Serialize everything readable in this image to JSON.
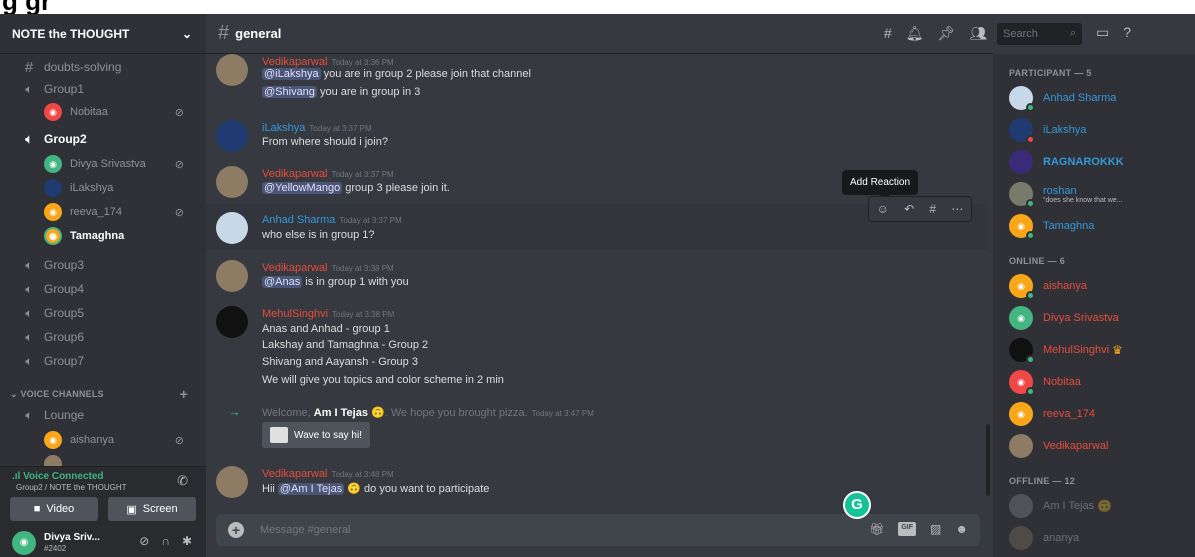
{
  "colors": {
    "online": "#43b581",
    "dnd": "#f04747",
    "idle": "#faa61a",
    "red_name": "#e74c3c",
    "blue_name": "#3498db",
    "accent": "#7289da"
  },
  "overlay_title": "g gr",
  "server": {
    "name": "NOTE the THOUGHT"
  },
  "sidebar": {
    "channels": [
      {
        "icon": "hash-icon",
        "label": "doubts-solving"
      },
      {
        "icon": "speaker-icon",
        "label": "Group1"
      },
      {
        "icon": "speaker-icon",
        "label": "Group2"
      },
      {
        "icon": "speaker-icon",
        "label": "Group3"
      },
      {
        "icon": "locked-speaker-icon",
        "label": "Group4"
      },
      {
        "icon": "locked-speaker-icon",
        "label": "Group5"
      },
      {
        "icon": "locked-speaker-icon",
        "label": "Group6"
      },
      {
        "icon": "locked-speaker-icon",
        "label": "Group7"
      },
      {
        "icon": "speaker-icon",
        "label": "Lounge"
      }
    ],
    "group1_users": [
      {
        "name": "Nobitaa"
      }
    ],
    "group2_users": [
      {
        "name": "Divya Srivastva"
      },
      {
        "name": "iLakshya"
      },
      {
        "name": "reeva_174"
      },
      {
        "name": "Tamaghna"
      }
    ],
    "lounge_users": [
      {
        "name": "aishanya"
      }
    ],
    "voice_category": "VOICE CHANNELS"
  },
  "voice": {
    "status": "Voice Connected",
    "location": "Group2 / NOTE the THOUGHT",
    "video_label": "Video",
    "screen_label": "Screen"
  },
  "user_panel": {
    "name": "Divya Sriv...",
    "tag": "#2402"
  },
  "channel": {
    "name": "general",
    "input_placeholder": "Message #general"
  },
  "search": {
    "placeholder": "Search"
  },
  "messages": [
    {
      "author": "Vedikaparwal",
      "time": "Today at 3:36 PM"
    },
    {
      "author": "iLakshya",
      "time": "Today at 3:37 PM",
      "text": "From where should i join?"
    },
    {
      "author": "Vedikaparwal",
      "time": "Today at 3:37 PM"
    },
    {
      "author": "Anhad Sharma",
      "time": "Today at 3:37 PM",
      "text": "who else is in group 1?"
    },
    {
      "author": "Vedikaparwal",
      "time": "Today at 3:38 PM"
    },
    {
      "author": "MehulSinghvi",
      "time": "Today at 3:38 PM",
      "lines": [
        "Anas and Anhad - group 1",
        "Lakshay and Tamaghna - Group 2",
        "Shivang  and Aayansh - Group 3",
        "We will give you topics and color scheme in 2 min"
      ]
    },
    {
      "author": "Vedikaparwal",
      "time": "Today at 3:48 PM"
    }
  ],
  "msg_parts": {
    "m1_mention1": "@iLakshya",
    "m1_text1": " you are in group 2 please join that channel",
    "m1_mention2": "@Shivang",
    "m1_text2": " you are in group in 3",
    "m3_mention": "@YellowMango",
    "m3_text": " group 3 please join it.",
    "m5_mention": "@Anas",
    "m5_text": " is in group 1 with you",
    "m7_pre": "Hii ",
    "m7_mention": "@Am I Tejas",
    "m7_text": "  do you want to participate"
  },
  "system_message": {
    "pre": "Welcome, ",
    "user": "Am I Tejas",
    "post": ". We hope you brought pizza.",
    "time": "Today at 3:47 PM",
    "button": "Wave to say hi!"
  },
  "tooltip": "Add Reaction",
  "members": {
    "participant_header": "PARTICIPANT — 5",
    "participants": [
      {
        "name": "Anhad Sharma"
      },
      {
        "name": "iLakshya"
      },
      {
        "name": "RAGNAROKKK"
      },
      {
        "name": "roshan",
        "status": "\"does she know that we..."
      },
      {
        "name": "Tamaghna"
      }
    ],
    "online_header": "ONLINE — 6",
    "online": [
      {
        "name": "aishanya"
      },
      {
        "name": "Divya Srivastva"
      },
      {
        "name": "MehulSinghvi"
      },
      {
        "name": "Nobitaa"
      },
      {
        "name": "reeva_174"
      },
      {
        "name": "Vedikaparwal"
      }
    ],
    "offline_header": "OFFLINE — 12",
    "offline": [
      {
        "name": "Am I Tejas"
      },
      {
        "name": "ananya"
      }
    ]
  }
}
